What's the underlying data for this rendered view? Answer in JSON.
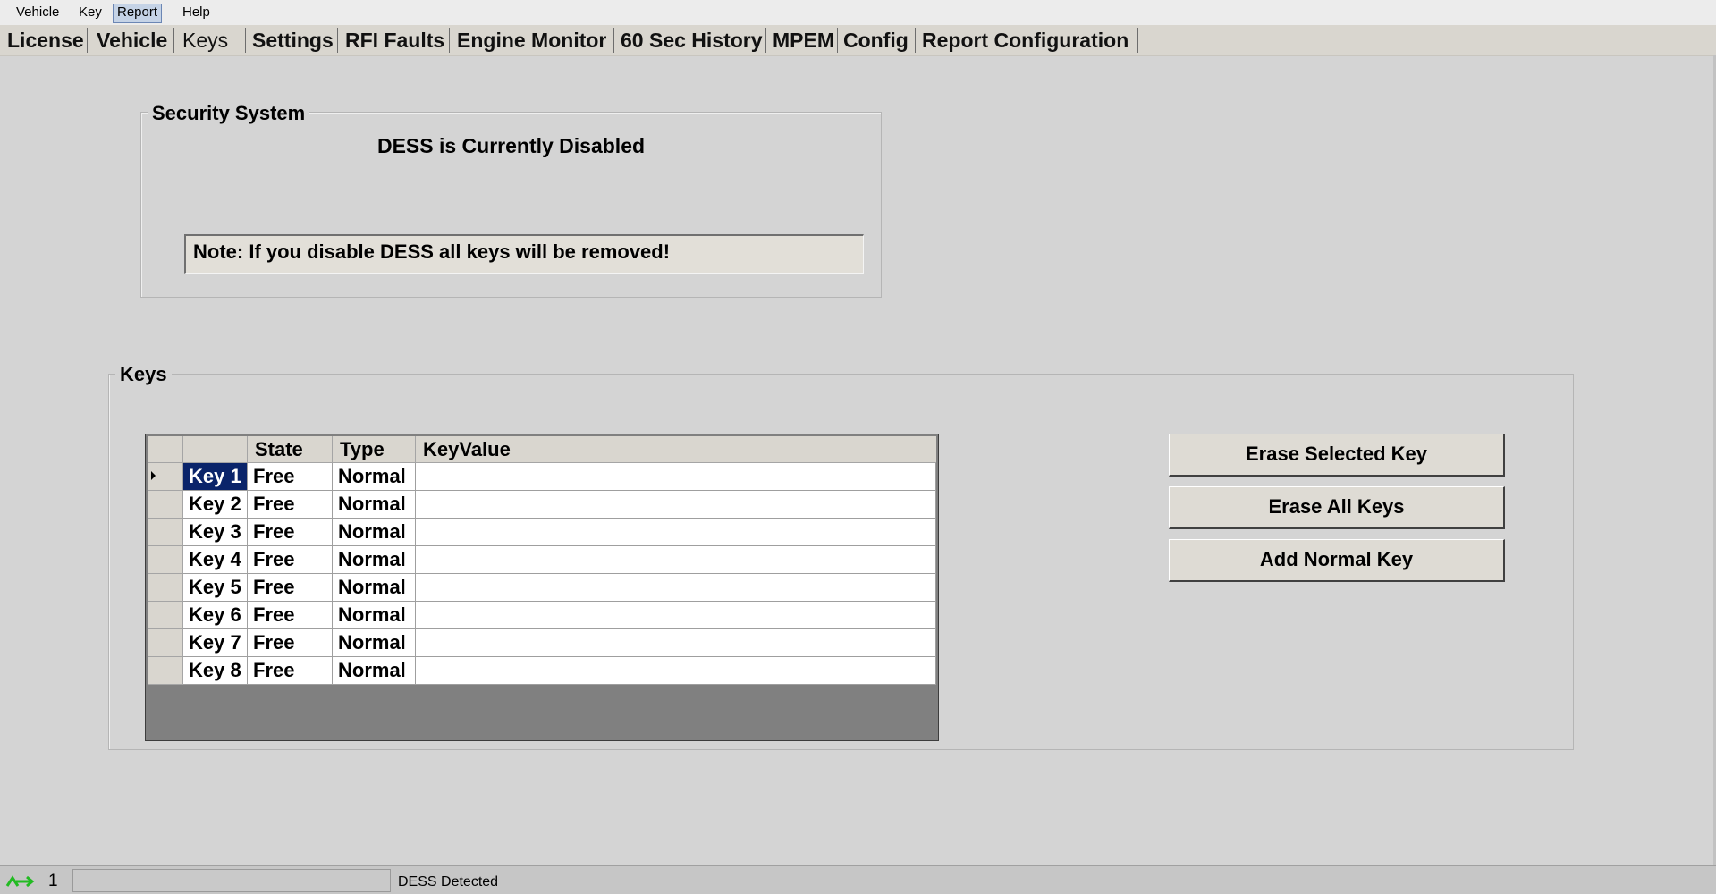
{
  "menu": {
    "items": [
      "Vehicle",
      "Key",
      "Report",
      "Help"
    ],
    "active": "Report"
  },
  "tabs": [
    "License",
    "Vehicle",
    "Keys",
    "Settings",
    "RFI Faults",
    "Engine Monitor",
    "60 Sec History",
    "MPEM",
    "Config",
    "Report Configuration"
  ],
  "active_tab": "Keys",
  "security": {
    "title": "Security System",
    "status": "DESS is Currently Disabled",
    "note": "Note: If you disable DESS all keys will be removed!"
  },
  "keys": {
    "title": "Keys",
    "columns": [
      "",
      "State",
      "Type",
      "KeyValue"
    ],
    "rows": [
      {
        "name": "Key 1",
        "state": "Free",
        "type": "Normal",
        "value": ""
      },
      {
        "name": "Key 2",
        "state": "Free",
        "type": "Normal",
        "value": ""
      },
      {
        "name": "Key 3",
        "state": "Free",
        "type": "Normal",
        "value": ""
      },
      {
        "name": "Key 4",
        "state": "Free",
        "type": "Normal",
        "value": ""
      },
      {
        "name": "Key 5",
        "state": "Free",
        "type": "Normal",
        "value": ""
      },
      {
        "name": "Key 6",
        "state": "Free",
        "type": "Normal",
        "value": ""
      },
      {
        "name": "Key 7",
        "state": "Free",
        "type": "Normal",
        "value": ""
      },
      {
        "name": "Key 8",
        "state": "Free",
        "type": "Normal",
        "value": ""
      }
    ],
    "selected_row": 0,
    "buttons": {
      "erase_selected": "Erase Selected  Key",
      "erase_all": "Erase All Keys",
      "add_normal": "Add Normal Key"
    }
  },
  "statusbar": {
    "count": "1",
    "message": "DESS Detected",
    "connection_icon": "connection-arrows-icon",
    "connection_color": "#22bb22"
  }
}
